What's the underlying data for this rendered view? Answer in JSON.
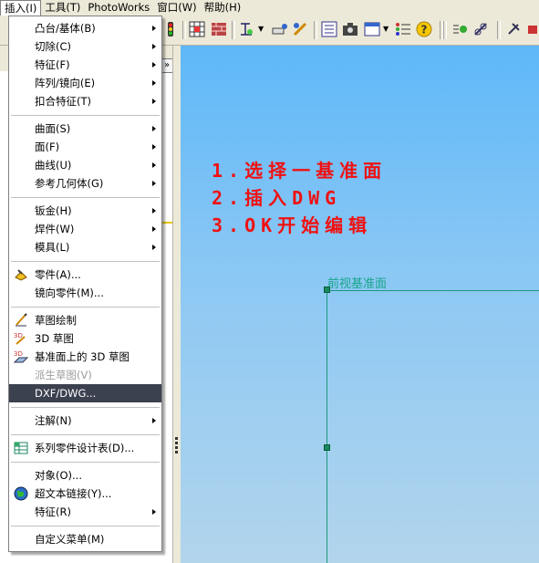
{
  "menubar": {
    "items": [
      {
        "label": "插入(I)"
      },
      {
        "label": "工具(T)"
      },
      {
        "label": "PhotoWorks"
      },
      {
        "label": "窗口(W)"
      },
      {
        "label": "帮助(H)"
      }
    ]
  },
  "canvas": {
    "annotations": [
      "1.选择一基准面",
      "2.插入DWG",
      "3.OK开始编辑"
    ],
    "plane_label": "前视基准面",
    "colors": {
      "annotation": "#f01010",
      "plane": "#1a9a7a"
    }
  },
  "panel": {
    "expand_glyph": "»"
  },
  "insert_menu": {
    "items": [
      {
        "label": "凸台/基体(B)",
        "submenu": true
      },
      {
        "label": "切除(C)",
        "submenu": true
      },
      {
        "label": "特征(F)",
        "submenu": true
      },
      {
        "label": "阵列/镜向(E)",
        "submenu": true
      },
      {
        "label": "扣合特征(T)",
        "submenu": true
      },
      {
        "label": "曲面(S)",
        "submenu": true
      },
      {
        "label": "面(F)",
        "submenu": true
      },
      {
        "label": "曲线(U)",
        "submenu": true
      },
      {
        "label": "参考几何体(G)",
        "submenu": true
      },
      {
        "label": "钣金(H)",
        "submenu": true
      },
      {
        "label": "焊件(W)",
        "submenu": true
      },
      {
        "label": "模具(L)",
        "submenu": true
      },
      {
        "label": "零件(A)...",
        "icon": "part-icon"
      },
      {
        "label": "镜向零件(M)..."
      },
      {
        "label": "草图绘制",
        "icon": "sketch-icon"
      },
      {
        "label": "3D 草图",
        "icon": "3d-sketch-icon"
      },
      {
        "label": "基准面上的 3D 草图",
        "icon": "plane-3d-sketch-icon"
      },
      {
        "label": "派生草图(V)",
        "disabled": true
      },
      {
        "label": "DXF/DWG...",
        "selected": true
      },
      {
        "label": "注解(N)",
        "submenu": true
      },
      {
        "label": "系列零件设计表(D)...",
        "icon": "design-table-icon"
      },
      {
        "label": "对象(O)..."
      },
      {
        "label": "超文本链接(Y)...",
        "icon": "globe-icon"
      },
      {
        "label": "特征(R)",
        "submenu": true
      },
      {
        "label": "自定义菜单(M)"
      }
    ]
  }
}
